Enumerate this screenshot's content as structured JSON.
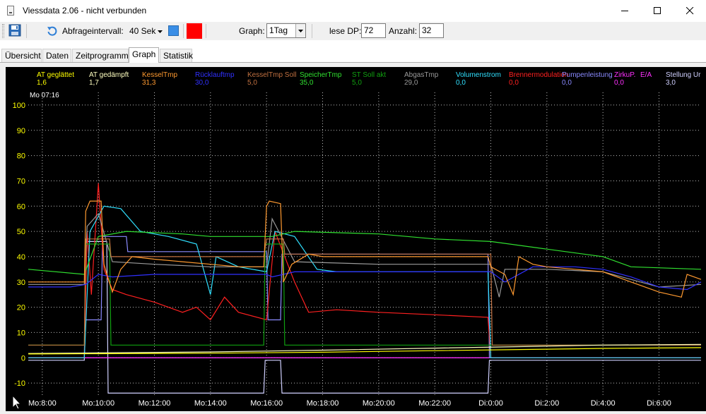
{
  "window": {
    "title": "Viessdata 2.06  -  nicht verbunden"
  },
  "toolbar": {
    "interval_label": "Abfrageintervall:",
    "interval_value": "40 Sek",
    "graph_label": "Graph:",
    "graph_value": "1Tag",
    "lese_dp_label": "lese DP:",
    "lese_dp_value": "72",
    "anzahl_label": "Anzahl:",
    "anzahl_value": "32",
    "status_color": "#ff0000",
    "accent_color": "#3a8ee6"
  },
  "tabs": [
    {
      "label": "Übersicht",
      "active": false
    },
    {
      "label": "Daten",
      "active": false
    },
    {
      "label": "Zeitprogramme",
      "active": false
    },
    {
      "label": "Graph",
      "active": true
    },
    {
      "label": "Statistik",
      "active": false
    }
  ],
  "chart_data": {
    "type": "line",
    "current_time_label": "Mo 07:16",
    "ylim": [
      -15,
      105
    ],
    "yticks": [
      -10,
      0,
      10,
      20,
      30,
      40,
      50,
      60,
      70,
      80,
      90,
      100
    ],
    "xlim": [
      7.5,
      31.5
    ],
    "xticks": [
      {
        "x": 8,
        "label": "Mo:8:00"
      },
      {
        "x": 10,
        "label": "Mo:10:00"
      },
      {
        "x": 12,
        "label": "Mo:12:00"
      },
      {
        "x": 14,
        "label": "Mo:14:00"
      },
      {
        "x": 16,
        "label": "Mo:16:00"
      },
      {
        "x": 18,
        "label": "Mo:18:00"
      },
      {
        "x": 20,
        "label": "Mo:20:00"
      },
      {
        "x": 22,
        "label": "Mo:22:00"
      },
      {
        "x": 24,
        "label": "Di:0:00"
      },
      {
        "x": 26,
        "label": "Di:2:00"
      },
      {
        "x": 28,
        "label": "Di:4:00"
      },
      {
        "x": 30,
        "label": "Di:6:00"
      }
    ],
    "grid": true,
    "legend_position": "top",
    "series": [
      {
        "name": "AT geglättet",
        "value": "1,6",
        "color": "#ffff00",
        "x": [
          7.5,
          10,
          14,
          18,
          22,
          26,
          28,
          31.5
        ],
        "y": [
          1.5,
          1.6,
          1.8,
          2.2,
          2.8,
          3.4,
          3.7,
          4.0
        ]
      },
      {
        "name": "AT gedämpft",
        "value": "1,7",
        "color": "#ffffc0",
        "x": [
          7.5,
          10,
          14,
          18,
          22,
          26,
          28,
          31.5
        ],
        "y": [
          1.7,
          1.9,
          2.3,
          3.0,
          3.8,
          4.6,
          5.0,
          5.3
        ]
      },
      {
        "name": "KesselTmp",
        "value": "31,3",
        "color": "#ff9a30",
        "x": [
          7.5,
          9.5,
          9.55,
          9.7,
          10.1,
          10.2,
          10.5,
          10.8,
          11.2,
          12,
          13,
          14,
          15,
          15.9,
          16.0,
          16.1,
          16.5,
          16.6,
          16.9,
          17.5,
          18,
          20,
          22,
          23.9,
          24.0,
          24.5,
          24.8,
          25.0,
          25.5,
          26,
          27,
          28,
          29,
          30,
          30.8,
          31.0,
          31.5
        ],
        "y": [
          30,
          30,
          58,
          62,
          62,
          37,
          26,
          35,
          40,
          39,
          38,
          37,
          36,
          36,
          60,
          62,
          61,
          30,
          37,
          41,
          40,
          40,
          40,
          40,
          36,
          33,
          25,
          40,
          37,
          36,
          35,
          34,
          30,
          26,
          24,
          33,
          31
        ]
      },
      {
        "name": "Rücklauftmp",
        "value": "30,0",
        "color": "#3030ff",
        "x": [
          7.5,
          9.0,
          9.55,
          10.0,
          10.5,
          12,
          13,
          14,
          16.0,
          16.2,
          17,
          19,
          22,
          24.0,
          24.5,
          25.5,
          26,
          27,
          28,
          29,
          30,
          31,
          31.5
        ],
        "y": [
          28,
          28,
          29,
          33,
          32,
          33,
          33,
          33,
          33,
          32,
          34,
          34,
          34,
          34,
          30,
          36,
          36,
          36,
          35,
          32,
          28,
          27,
          30
        ]
      },
      {
        "name": "KesselTmp Soll",
        "value": "5,0",
        "color": "#c07040",
        "x": [
          7.5,
          9.5,
          9.55,
          10.4,
          10.45,
          15.9,
          16.0,
          16.6,
          16.65,
          24.0,
          24.05,
          31.5
        ],
        "y": [
          5,
          5,
          47,
          47,
          40,
          40,
          47,
          47,
          41,
          41,
          5,
          5
        ]
      },
      {
        "name": "SpeicherTmp",
        "value": "35,0",
        "color": "#30e030",
        "x": [
          7.5,
          9.5,
          10.0,
          11.0,
          13.0,
          14.0,
          16.2,
          17.0,
          20,
          22,
          24,
          26,
          28,
          29,
          31.5
        ],
        "y": [
          35,
          33,
          48,
          50,
          49,
          48,
          48,
          50,
          49,
          47,
          46,
          43,
          40,
          36,
          35
        ]
      },
      {
        "name": "ST Soll akt",
        "value": "5,0",
        "color": "#10a010",
        "x": [
          7.5,
          9.5,
          9.55,
          10.4,
          10.45,
          15.9,
          15.95,
          16.6,
          16.65,
          31.5
        ],
        "y": [
          5,
          5,
          45,
          45,
          5,
          5,
          45,
          45,
          5,
          5
        ]
      },
      {
        "name": "AbgasTmp",
        "value": "29,0",
        "color": "#9a9a9a",
        "x": [
          7.5,
          9.5,
          9.6,
          10.0,
          10.5,
          12,
          14,
          16.0,
          16.2,
          17,
          20,
          24.0,
          24.3,
          24.5,
          26,
          28,
          29,
          30,
          31.5
        ],
        "y": [
          29,
          29,
          52,
          57,
          38,
          37,
          36,
          36,
          55,
          38,
          37,
          37,
          24,
          35,
          35,
          34,
          31,
          28,
          29
        ]
      },
      {
        "name": "Volumenstrom",
        "value": "0,0",
        "color": "#30e0ff",
        "x": [
          7.5,
          9.5,
          9.7,
          10.2,
          10.8,
          11.5,
          12.5,
          13.5,
          14.0,
          14.2,
          15.0,
          16.0,
          16.3,
          17.0,
          17.8,
          18.5,
          20,
          22,
          23.9,
          24.0,
          31.5
        ],
        "y": [
          0,
          0,
          50,
          60,
          59,
          50,
          48,
          45,
          25,
          40,
          36,
          34,
          50,
          48,
          35,
          34,
          34,
          34,
          34,
          0,
          0
        ]
      },
      {
        "name": "Brennermodulation",
        "value": "0,0",
        "color": "#ff2020",
        "x": [
          7.5,
          9.5,
          9.6,
          9.75,
          10.0,
          10.2,
          10.5,
          11.0,
          12.0,
          13.0,
          13.5,
          14.0,
          14.5,
          15.0,
          16.0,
          16.3,
          17.0,
          17.5,
          18.5,
          20,
          22,
          23.9,
          24.0,
          31.5
        ],
        "y": [
          0,
          0,
          50,
          25,
          69,
          35,
          27,
          25,
          22,
          18,
          20,
          15,
          24,
          18,
          15,
          50,
          30,
          18,
          19,
          18,
          17,
          16,
          0,
          0
        ]
      },
      {
        "name": "Pumpenleistung",
        "value": "0,0",
        "color": "#8a8aff",
        "x": [
          7.5,
          9.5,
          9.55,
          10.1,
          10.15,
          11.0,
          11.05,
          16.0,
          16.05,
          16.5,
          16.55,
          23.9,
          23.95,
          31.5
        ],
        "y": [
          0,
          0,
          15,
          15,
          48,
          48,
          42,
          42,
          15,
          15,
          41,
          41,
          0,
          0
        ]
      },
      {
        "name": "ZirkuP.",
        "value": "0,0",
        "color": "#ff30ff",
        "x": [
          7.5,
          31.5
        ],
        "y": [
          0,
          0
        ]
      },
      {
        "name": "E/A",
        "value": "",
        "color": "#ff30ff",
        "x": [
          7.5,
          31.5
        ],
        "y": [
          0,
          0
        ]
      },
      {
        "name": "Stellung Ur",
        "value": "3,0",
        "color": "#d0d0ff",
        "x": [
          7.5,
          9.5,
          9.55,
          10.3,
          10.35,
          15.9,
          15.95,
          16.5,
          16.55,
          23.9,
          23.95,
          31.5
        ],
        "y": [
          -1,
          -1,
          46,
          46,
          -14,
          -14,
          -1,
          -1,
          -14,
          -14,
          -1,
          -1
        ]
      }
    ]
  }
}
